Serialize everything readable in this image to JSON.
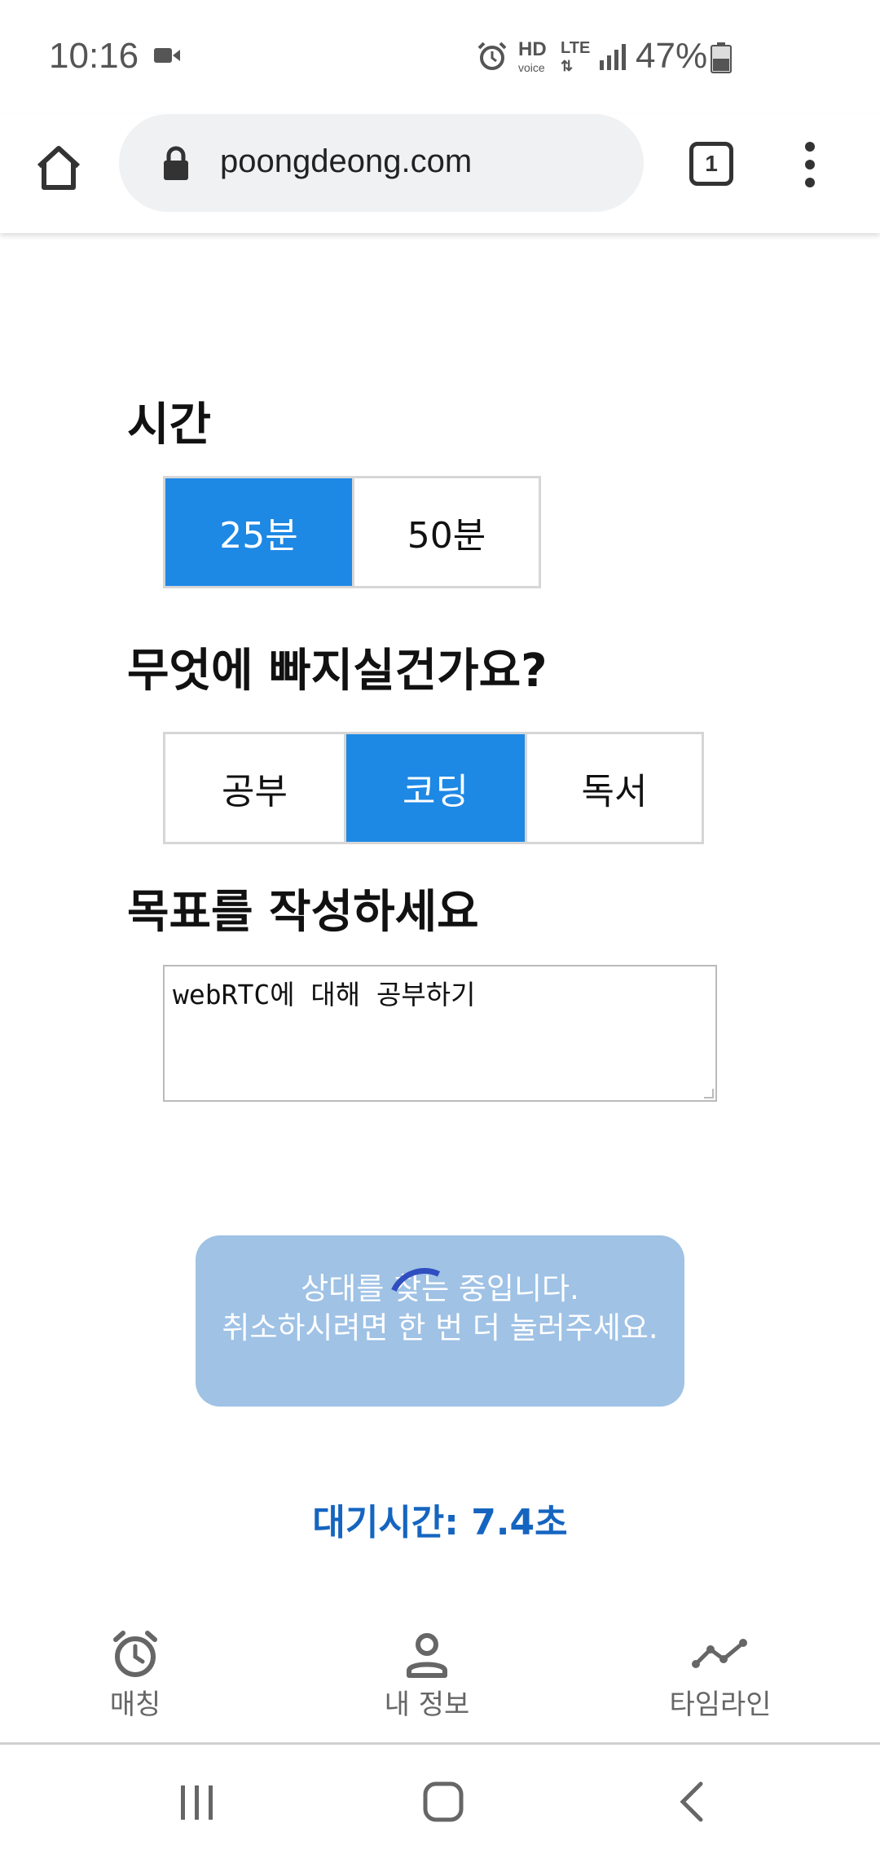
{
  "status_bar": {
    "time": "10:16",
    "battery": "47%",
    "hd": "HD",
    "voice": "voice",
    "lte": "LTE"
  },
  "browser": {
    "url": "poongdeong.com",
    "tab_count": "1"
  },
  "time_section": {
    "title": "시간",
    "options": [
      "25분",
      "50분"
    ],
    "selected": "25분"
  },
  "activity_section": {
    "title": "무엇에 빠지실건가요?",
    "options": [
      "공부",
      "코딩",
      "독서"
    ],
    "selected": "코딩"
  },
  "goal_section": {
    "title": "목표를 작성하세요",
    "value": "webRTC에 대해 공부하기"
  },
  "match_button": {
    "line1": "상대를 찾는 중입니다.",
    "line2": "취소하시려면 한 번 더 눌러주세요."
  },
  "wait_time": "대기시간: 7.4초",
  "bottom_nav": {
    "items": [
      {
        "label": "매칭",
        "icon": "alarm-clock-icon"
      },
      {
        "label": "내 정보",
        "icon": "person-icon"
      },
      {
        "label": "타임라인",
        "icon": "line-chart-icon"
      }
    ]
  },
  "colors": {
    "accent": "#1e88e5",
    "button_disabled": "#9fc2e5",
    "wait_text": "#1565c0",
    "spinner": "#2f4ec0"
  }
}
